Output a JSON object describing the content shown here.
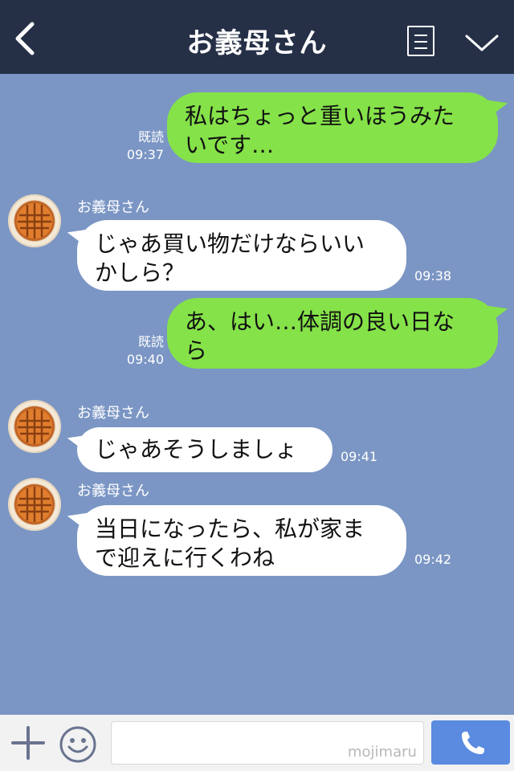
{
  "header": {
    "title": "お義母さん",
    "back_icon": "chevron-left-icon",
    "menu_icon": "list-icon",
    "more_icon": "chevron-down-icon",
    "background": "#253047"
  },
  "chat": {
    "background": "#7b96c4",
    "messages": [
      {
        "direction": "out",
        "text_lines": [
          "私はちょっと重いほうみた",
          "いです…"
        ],
        "read_label": "既読",
        "time": "09:37"
      },
      {
        "direction": "in",
        "sender": "お義母さん",
        "text_lines": [
          "じゃあ買い物だけならいい",
          "かしら？"
        ],
        "time": "09:38"
      },
      {
        "direction": "out",
        "text_lines": [
          "あ、はい…体調の良い日な",
          "ら"
        ],
        "read_label": "既読",
        "time": "09:40"
      },
      {
        "direction": "in",
        "sender": "お義母さん",
        "text_lines": [
          "じゃあそうしましょ"
        ],
        "time": "09:41"
      },
      {
        "direction": "in",
        "sender": "お義母さん",
        "text_lines": [
          "当日になったら、私が家ま",
          "で迎えに行くわね"
        ],
        "time": "09:42"
      }
    ],
    "outgoing_color": "#85e249",
    "incoming_color": "#ffffff"
  },
  "composer": {
    "input_value": "",
    "watermark": "mojimaru",
    "plus_icon": "plus-icon",
    "emoji_icon": "smiley-icon",
    "call_icon": "phone-icon",
    "call_color": "#5a8be0"
  }
}
